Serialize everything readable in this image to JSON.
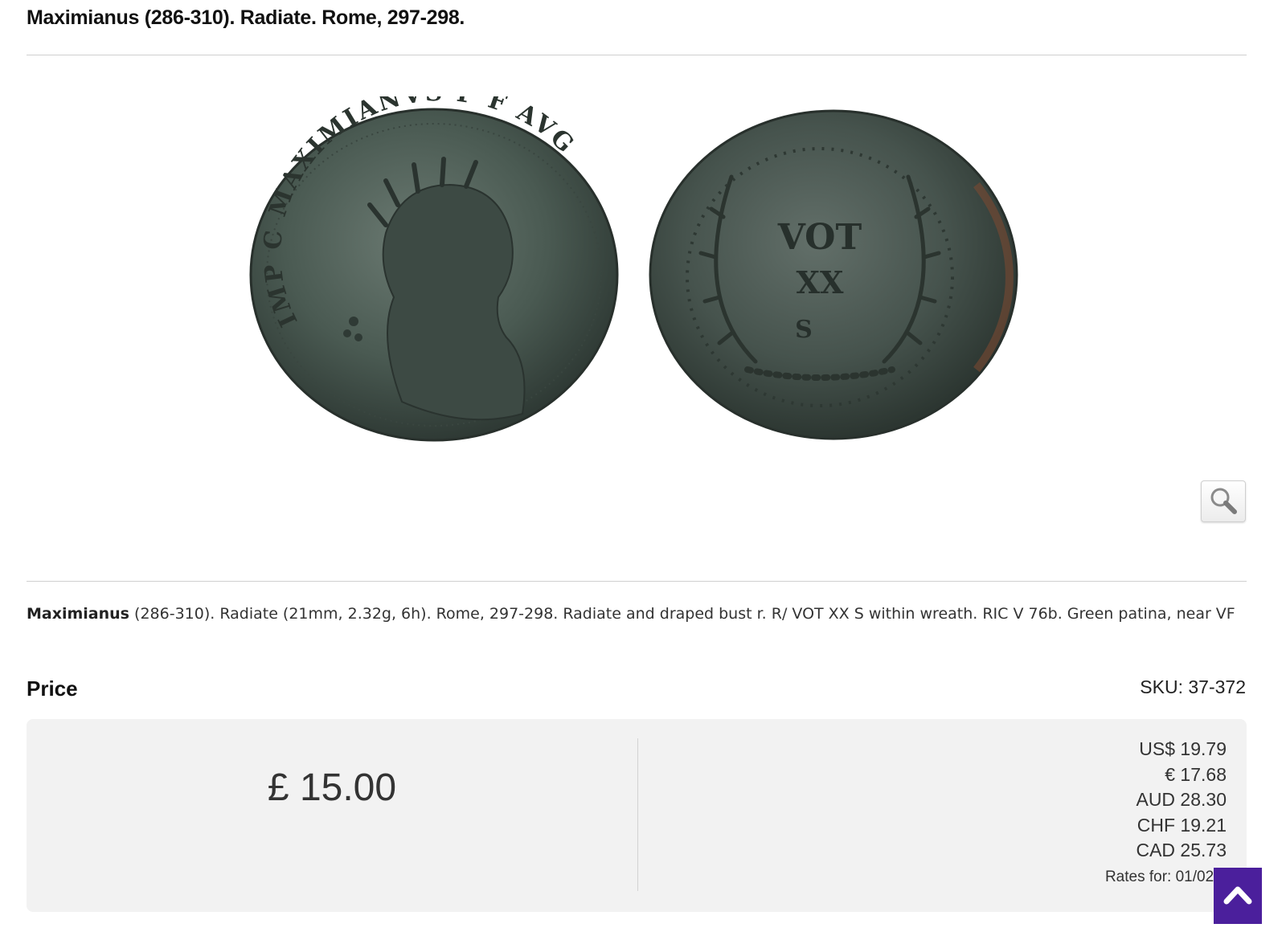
{
  "product": {
    "title": "Maximianus (286-310). Radiate. Rome, 297-298.",
    "description_lead": "Maximianus",
    "description_rest": " (286-310). Radiate (21mm, 2.32g, 6h). Rome, 297-298. Radiate and draped bust r. R/ VOT XX S within wreath. RIC V 76b. Green patina, near VF",
    "obverse_legend": "IMP C MAXIMIANVS P F AVG",
    "reverse_text": [
      "VOT",
      "XX",
      "S"
    ]
  },
  "pricing": {
    "label": "Price",
    "sku": "SKU: 37-372",
    "main_price": "£ 15.00",
    "conversions": [
      "US$ 19.79",
      "€ 17.68",
      "AUD 28.30",
      "CHF 19.21",
      "CAD 25.73"
    ],
    "rates_note": "Rates for: 01/02/2"
  },
  "icons": {
    "zoom": "magnifier-icon",
    "back_to_top": "chevron-up-icon"
  },
  "colors": {
    "accent": "#4b1f9c",
    "coin_patina": "#4a5a52"
  }
}
